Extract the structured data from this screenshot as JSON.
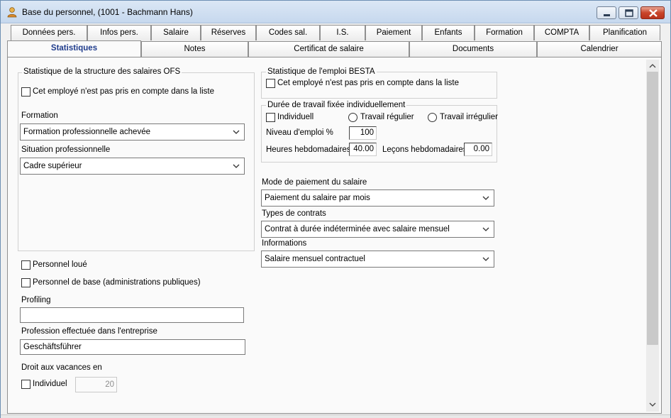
{
  "window": {
    "title": "Base du personnel, (1001 - Bachmann Hans)"
  },
  "icons": {
    "app": "user-person-icon",
    "minimize": "minimize-icon",
    "maximize": "maximize-icon",
    "close": "close-icon",
    "dropdown": "chevron-down-icon",
    "scroll_up": "chevron-up-icon",
    "scroll_down": "chevron-down-icon"
  },
  "colors": {
    "active_tab_text": "#1f3c8c",
    "close_button": "#c9452b"
  },
  "tabs_row1": [
    "Données pers.",
    "Infos pers.",
    "Salaire",
    "Réserves",
    "Codes sal.",
    "I.S.",
    "Paiement",
    "Enfants",
    "Formation",
    "COMPTA",
    "Planification"
  ],
  "tabs_row2": [
    "Statistiques",
    "Notes",
    "Certificat de salaire",
    "Documents",
    "Calendrier"
  ],
  "ofs": {
    "group_title": "Statistique de la structure des salaires OFS",
    "exclude_label": "Cet employé n'est pas pris en compte dans la liste",
    "formation_label": "Formation",
    "formation_value": "Formation professionnelle achevée",
    "situation_label": "Situation professionnelle",
    "situation_value": "Cadre supérieur"
  },
  "besta": {
    "group_title": "Statistique de l'emploi BESTA",
    "exclude_label": "Cet employé n'est pas pris en compte dans la liste"
  },
  "duree": {
    "group_title": "Durée de travail fixée individuellement",
    "individuell_label": "Individuell",
    "regulier_label": "Travail régulier",
    "irregulier_label": "Travail irrégulier",
    "niveau_label": "Niveau d'emploi %",
    "niveau_value": "100",
    "heures_label": "Heures hebdomadaires",
    "heures_value": "40.00",
    "lecons_label": "Leçons hebdomadaires",
    "lecons_value": "0.00"
  },
  "paiement": {
    "mode_label": "Mode de paiement du salaire",
    "mode_value": "Paiement du salaire par mois",
    "contrats_label": "Types de contrats",
    "contrats_value": "Contrat à durée indéterminée avec salaire mensuel",
    "informations_label": "Informations",
    "informations_value": "Salaire mensuel contractuel"
  },
  "misc": {
    "personnel_loue_label": "Personnel loué",
    "personnel_base_label": "Personnel de base (administrations publiques)",
    "profiling_label": "Profiling",
    "profiling_value": "",
    "profession_label": "Profession effectuée dans l'entreprise",
    "profession_value": "Geschäftsführer",
    "vacances_label": "Droit aux vacances en",
    "vacances_individuel_label": "Individuel",
    "vacances_value": "20"
  }
}
